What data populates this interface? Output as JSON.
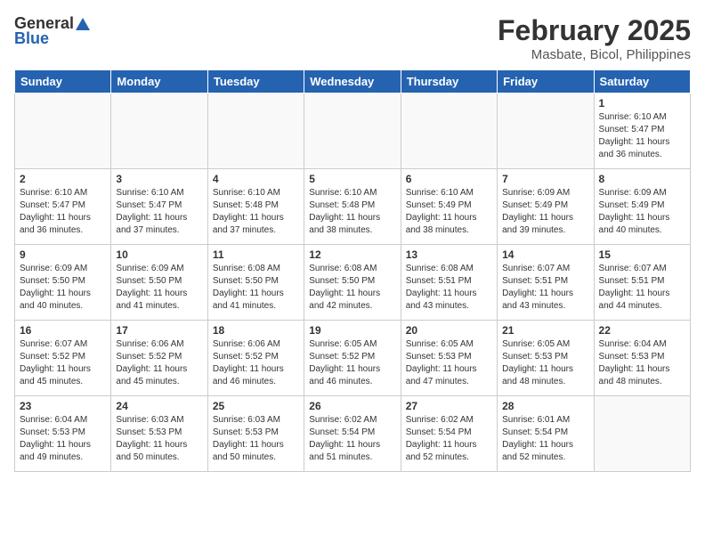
{
  "header": {
    "logo_general": "General",
    "logo_blue": "Blue",
    "month_year": "February 2025",
    "location": "Masbate, Bicol, Philippines"
  },
  "weekdays": [
    "Sunday",
    "Monday",
    "Tuesday",
    "Wednesday",
    "Thursday",
    "Friday",
    "Saturday"
  ],
  "weeks": [
    [
      {
        "day": "",
        "info": ""
      },
      {
        "day": "",
        "info": ""
      },
      {
        "day": "",
        "info": ""
      },
      {
        "day": "",
        "info": ""
      },
      {
        "day": "",
        "info": ""
      },
      {
        "day": "",
        "info": ""
      },
      {
        "day": "1",
        "info": "Sunrise: 6:10 AM\nSunset: 5:47 PM\nDaylight: 11 hours and 36 minutes."
      }
    ],
    [
      {
        "day": "2",
        "info": "Sunrise: 6:10 AM\nSunset: 5:47 PM\nDaylight: 11 hours and 36 minutes."
      },
      {
        "day": "3",
        "info": "Sunrise: 6:10 AM\nSunset: 5:47 PM\nDaylight: 11 hours and 37 minutes."
      },
      {
        "day": "4",
        "info": "Sunrise: 6:10 AM\nSunset: 5:48 PM\nDaylight: 11 hours and 37 minutes."
      },
      {
        "day": "5",
        "info": "Sunrise: 6:10 AM\nSunset: 5:48 PM\nDaylight: 11 hours and 38 minutes."
      },
      {
        "day": "6",
        "info": "Sunrise: 6:10 AM\nSunset: 5:49 PM\nDaylight: 11 hours and 38 minutes."
      },
      {
        "day": "7",
        "info": "Sunrise: 6:09 AM\nSunset: 5:49 PM\nDaylight: 11 hours and 39 minutes."
      },
      {
        "day": "8",
        "info": "Sunrise: 6:09 AM\nSunset: 5:49 PM\nDaylight: 11 hours and 40 minutes."
      }
    ],
    [
      {
        "day": "9",
        "info": "Sunrise: 6:09 AM\nSunset: 5:50 PM\nDaylight: 11 hours and 40 minutes."
      },
      {
        "day": "10",
        "info": "Sunrise: 6:09 AM\nSunset: 5:50 PM\nDaylight: 11 hours and 41 minutes."
      },
      {
        "day": "11",
        "info": "Sunrise: 6:08 AM\nSunset: 5:50 PM\nDaylight: 11 hours and 41 minutes."
      },
      {
        "day": "12",
        "info": "Sunrise: 6:08 AM\nSunset: 5:50 PM\nDaylight: 11 hours and 42 minutes."
      },
      {
        "day": "13",
        "info": "Sunrise: 6:08 AM\nSunset: 5:51 PM\nDaylight: 11 hours and 43 minutes."
      },
      {
        "day": "14",
        "info": "Sunrise: 6:07 AM\nSunset: 5:51 PM\nDaylight: 11 hours and 43 minutes."
      },
      {
        "day": "15",
        "info": "Sunrise: 6:07 AM\nSunset: 5:51 PM\nDaylight: 11 hours and 44 minutes."
      }
    ],
    [
      {
        "day": "16",
        "info": "Sunrise: 6:07 AM\nSunset: 5:52 PM\nDaylight: 11 hours and 45 minutes."
      },
      {
        "day": "17",
        "info": "Sunrise: 6:06 AM\nSunset: 5:52 PM\nDaylight: 11 hours and 45 minutes."
      },
      {
        "day": "18",
        "info": "Sunrise: 6:06 AM\nSunset: 5:52 PM\nDaylight: 11 hours and 46 minutes."
      },
      {
        "day": "19",
        "info": "Sunrise: 6:05 AM\nSunset: 5:52 PM\nDaylight: 11 hours and 46 minutes."
      },
      {
        "day": "20",
        "info": "Sunrise: 6:05 AM\nSunset: 5:53 PM\nDaylight: 11 hours and 47 minutes."
      },
      {
        "day": "21",
        "info": "Sunrise: 6:05 AM\nSunset: 5:53 PM\nDaylight: 11 hours and 48 minutes."
      },
      {
        "day": "22",
        "info": "Sunrise: 6:04 AM\nSunset: 5:53 PM\nDaylight: 11 hours and 48 minutes."
      }
    ],
    [
      {
        "day": "23",
        "info": "Sunrise: 6:04 AM\nSunset: 5:53 PM\nDaylight: 11 hours and 49 minutes."
      },
      {
        "day": "24",
        "info": "Sunrise: 6:03 AM\nSunset: 5:53 PM\nDaylight: 11 hours and 50 minutes."
      },
      {
        "day": "25",
        "info": "Sunrise: 6:03 AM\nSunset: 5:53 PM\nDaylight: 11 hours and 50 minutes."
      },
      {
        "day": "26",
        "info": "Sunrise: 6:02 AM\nSunset: 5:54 PM\nDaylight: 11 hours and 51 minutes."
      },
      {
        "day": "27",
        "info": "Sunrise: 6:02 AM\nSunset: 5:54 PM\nDaylight: 11 hours and 52 minutes."
      },
      {
        "day": "28",
        "info": "Sunrise: 6:01 AM\nSunset: 5:54 PM\nDaylight: 11 hours and 52 minutes."
      },
      {
        "day": "",
        "info": ""
      }
    ]
  ]
}
